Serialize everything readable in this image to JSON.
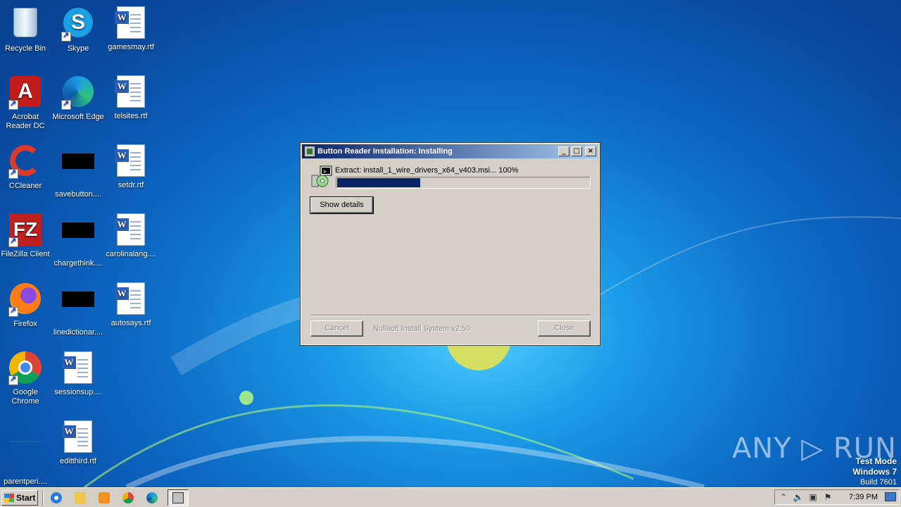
{
  "desktop_icons": [
    {
      "label": "Recycle Bin"
    },
    {
      "label": "Skype"
    },
    {
      "label": "gamesmay.rtf"
    },
    {
      "label": "Acrobat Reader DC"
    },
    {
      "label": "Microsoft Edge"
    },
    {
      "label": "telsites.rtf"
    },
    {
      "label": "CCleaner"
    },
    {
      "label": "savebutton...."
    },
    {
      "label": "setdr.rtf"
    },
    {
      "label": "FileZilla Client"
    },
    {
      "label": "chargethink...."
    },
    {
      "label": "carolinalang...."
    },
    {
      "label": "Firefox"
    },
    {
      "label": "linedictionar...."
    },
    {
      "label": "autosays.rtf"
    },
    {
      "label": "Google Chrome"
    },
    {
      "label": "sessionsup...."
    },
    {
      "label": "parentperi...."
    },
    {
      "label": "editthird.rtf"
    }
  ],
  "installer": {
    "title": "Button Reader Installation: Installing",
    "status_text": "Extract: install_1_wire_drivers_x64_v403.msi... 100%",
    "progress_fraction": 0.33,
    "show_details_label": "Show details",
    "cancel_label": "Cancel",
    "branding": "Nullsoft Install System v2.50",
    "close_label": "Close"
  },
  "taskbar": {
    "start_label": "Start",
    "clock": "7:39 PM"
  },
  "watermark": {
    "text": "ANY ▷ RUN",
    "mode": "Test Mode",
    "os": "Windows 7",
    "build": "Build 7601"
  }
}
